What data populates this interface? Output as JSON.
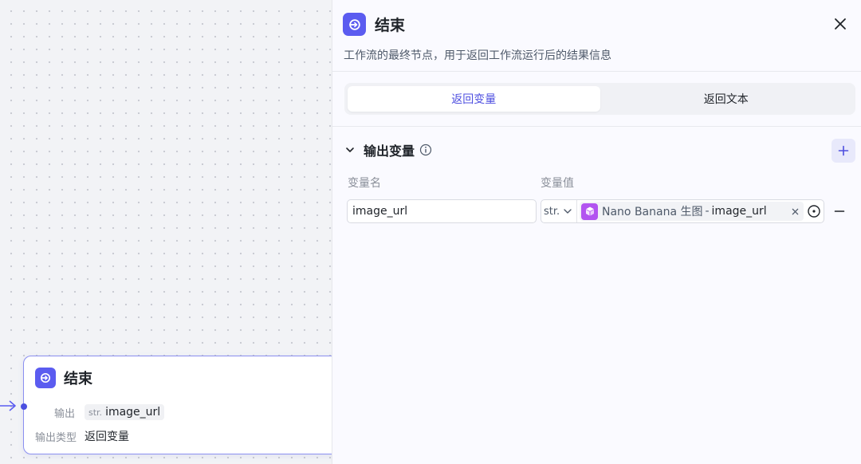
{
  "canvas": {
    "node": {
      "title": "结束",
      "output_label": "输出",
      "output_type": "str.",
      "output_name": "image_url",
      "type_label": "输出类型",
      "type_value": "返回变量"
    }
  },
  "panel": {
    "title": "结束",
    "description": "工作流的最终节点，用于返回工作流运行后的结果信息",
    "tabs": [
      {
        "label": "返回变量",
        "active": true
      },
      {
        "label": "返回文本",
        "active": false
      }
    ],
    "section": {
      "title": "输出变量",
      "col_name_label": "变量名",
      "col_value_label": "变量值",
      "rows": [
        {
          "name": "image_url",
          "type": "str.",
          "ref_node": "Nano Banana 生图",
          "ref_sep": "-",
          "ref_var": "image_url"
        }
      ]
    }
  },
  "colors": {
    "accent": "#5b5cf0",
    "accent_text": "#4e4fe0",
    "ref_icon": "#b254f0",
    "node_border": "#8b8ff0"
  },
  "icons": {
    "node_icon": "exit-arrow-icon",
    "close": "close-icon",
    "collapse": "chevron-down-icon",
    "info": "info-icon",
    "add": "plus-icon",
    "type_dropdown": "chevron-down-icon",
    "ref_node": "cube-icon",
    "clear": "x-icon",
    "target": "target-icon",
    "remove": "minus-icon"
  }
}
